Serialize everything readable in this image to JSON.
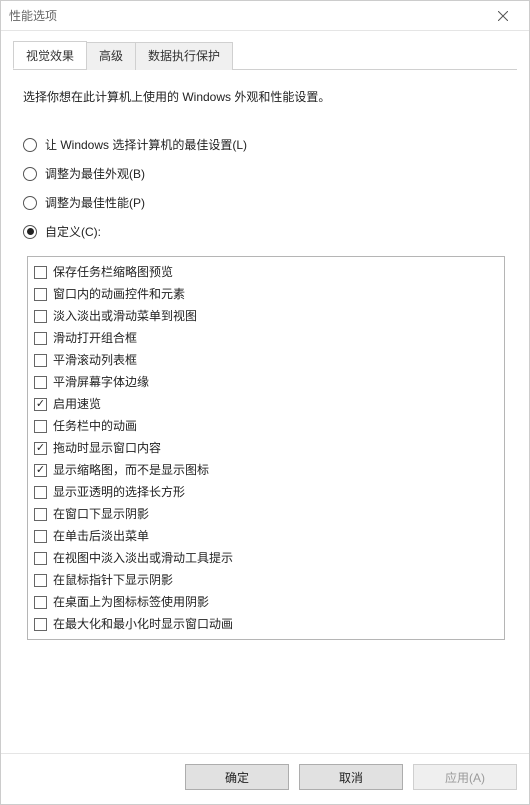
{
  "window": {
    "title": "性能选项"
  },
  "tabs": {
    "visual": "视觉效果",
    "advanced": "高级",
    "dep": "数据执行保护"
  },
  "description": "选择你想在此计算机上使用的 Windows 外观和性能设置。",
  "radios": {
    "best_windows": "让 Windows 选择计算机的最佳设置(L)",
    "best_appearance": "调整为最佳外观(B)",
    "best_performance": "调整为最佳性能(P)",
    "custom": "自定义(C):"
  },
  "options": [
    {
      "label": "保存任务栏缩略图预览",
      "checked": false
    },
    {
      "label": "窗口内的动画控件和元素",
      "checked": false
    },
    {
      "label": "淡入淡出或滑动菜单到视图",
      "checked": false
    },
    {
      "label": "滑动打开组合框",
      "checked": false
    },
    {
      "label": "平滑滚动列表框",
      "checked": false
    },
    {
      "label": "平滑屏幕字体边缘",
      "checked": false
    },
    {
      "label": "启用速览",
      "checked": true
    },
    {
      "label": "任务栏中的动画",
      "checked": false
    },
    {
      "label": "拖动时显示窗口内容",
      "checked": true
    },
    {
      "label": "显示缩略图，而不是显示图标",
      "checked": true
    },
    {
      "label": "显示亚透明的选择长方形",
      "checked": false
    },
    {
      "label": "在窗口下显示阴影",
      "checked": false
    },
    {
      "label": "在单击后淡出菜单",
      "checked": false
    },
    {
      "label": "在视图中淡入淡出或滑动工具提示",
      "checked": false
    },
    {
      "label": "在鼠标指针下显示阴影",
      "checked": false
    },
    {
      "label": "在桌面上为图标标签使用阴影",
      "checked": false
    },
    {
      "label": "在最大化和最小化时显示窗口动画",
      "checked": false
    }
  ],
  "buttons": {
    "ok": "确定",
    "cancel": "取消",
    "apply": "应用(A)"
  }
}
